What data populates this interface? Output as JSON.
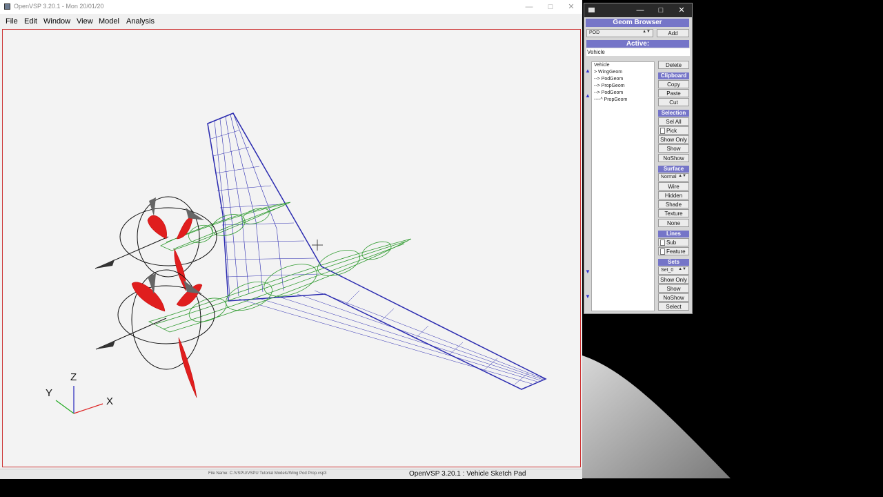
{
  "main_window": {
    "title": "OpenVSP 3.20.1 - Mon 20/01/20",
    "menu": [
      "File",
      "Edit",
      "Window",
      "View",
      "Model",
      "Analysis"
    ],
    "status": {
      "file_name": "File Name: C:/VSPU/VSPU Tutorial Models/Wing Pod Prop.vsp3",
      "text": "OpenVSP 3.20.1 : Vehicle Sketch Pad"
    },
    "axes": {
      "z": "Z",
      "y": "Y",
      "x": "X"
    }
  },
  "geom_browser": {
    "title": "Geom Browser",
    "type_value": "POD",
    "add_label": "Add",
    "active_label": "Active:",
    "active_value": "Vehicle",
    "tree": [
      "Vehicle",
      "> WingGeom",
      "--> PodGeom",
      "--> PropGeom",
      "--> PodGeom",
      "----^ PropGeom"
    ],
    "delete_label": "Delete",
    "clipboard": {
      "header": "Clipboard",
      "copy": "Copy",
      "paste": "Paste",
      "cut": "Cut"
    },
    "selection": {
      "header": "Selection",
      "sel_all": "Sel All",
      "pick": "Pick",
      "show_only": "Show Only",
      "show": "Show",
      "no_show": "NoShow"
    },
    "surface": {
      "header": "Surface",
      "mode": "Normal",
      "wire": "Wire",
      "hidden": "Hidden",
      "shade": "Shade",
      "texture": "Texture",
      "none": "None"
    },
    "lines": {
      "header": "Lines",
      "sub": "Sub",
      "feature": "Feature"
    },
    "sets": {
      "header": "Sets",
      "set_value": "Set_0",
      "show_only": "Show Only",
      "show": "Show",
      "no_show": "NoShow",
      "select": "Select"
    }
  },
  "colors": {
    "wing": "#2b2bb0",
    "pod": "#2e9a2e",
    "prop": "#e01e1e",
    "viewport_border": "#cc3333",
    "header": "#7575c8"
  }
}
